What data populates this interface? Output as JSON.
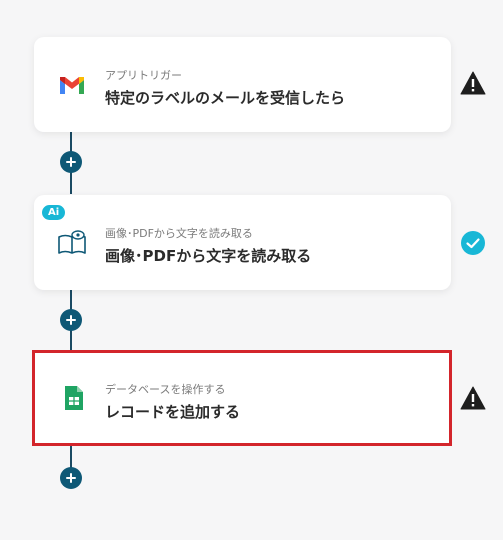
{
  "flow": {
    "steps": [
      {
        "subtitle": "アプリトリガー",
        "title": "特定のラベルのメールを受信したら",
        "icon": "gmail-icon",
        "status": "warning-icon"
      },
      {
        "badge": "Ai",
        "subtitle": "画像･PDFから文字を読み取る",
        "title": "画像･PDFから文字を読み取る",
        "icon": "ocr-book-icon",
        "status": "check-icon"
      },
      {
        "subtitle": "データベースを操作する",
        "title": "レコードを追加する",
        "icon": "google-sheets-icon",
        "status": "warning-icon"
      }
    ]
  },
  "colors": {
    "connector": "#1a4a63",
    "add_button": "#0e5876",
    "selected_border": "#d3252b",
    "check": "#18b7d6",
    "ai_badge": "#18b7d6"
  }
}
